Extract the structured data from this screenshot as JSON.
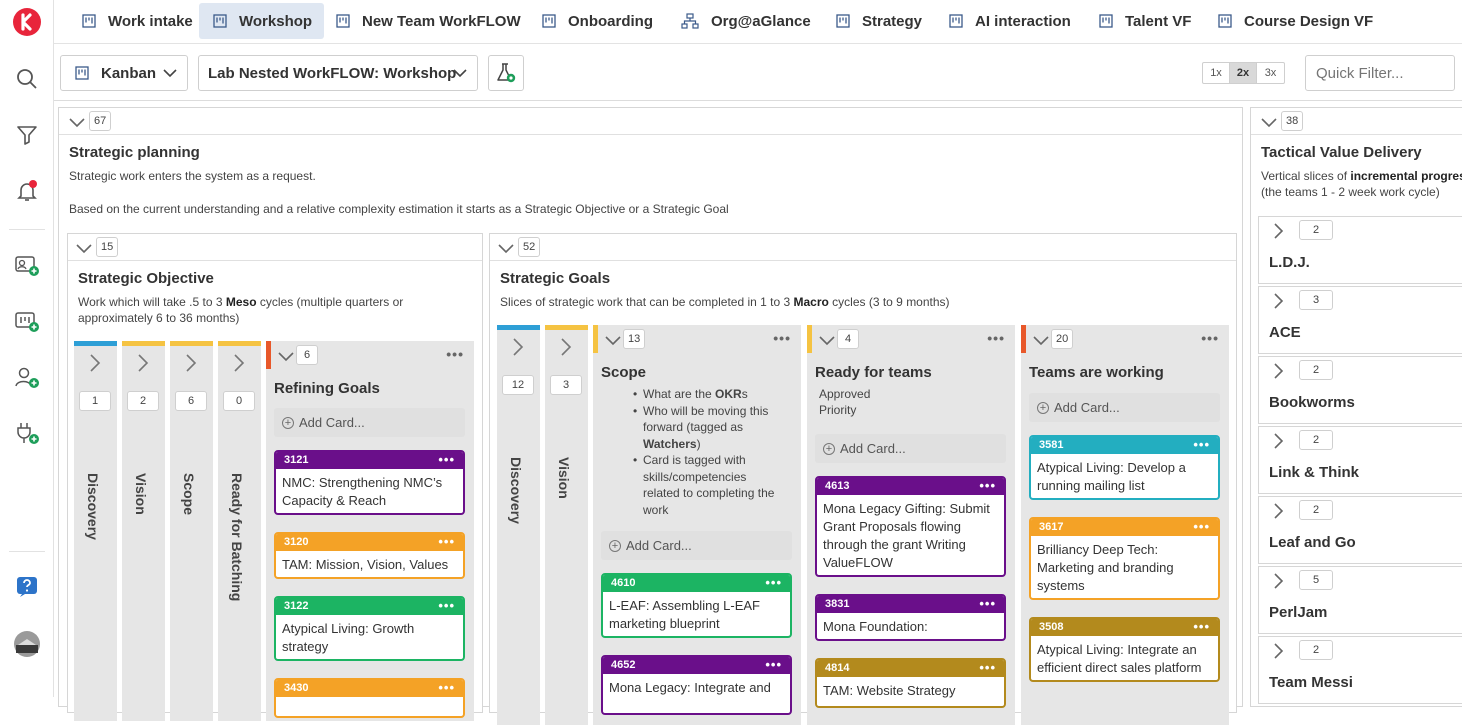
{
  "tabs": [
    {
      "label": "Work intake",
      "icon": "board-icon"
    },
    {
      "label": "Workshop",
      "icon": "board-icon",
      "active": true
    },
    {
      "label": "New Team WorkFLOW",
      "icon": "board-icon"
    },
    {
      "label": "Onboarding",
      "icon": "board-icon"
    },
    {
      "label": "Org@aGlance",
      "icon": "org-chart-icon"
    },
    {
      "label": "Strategy",
      "icon": "board-icon"
    },
    {
      "label": "AI interaction",
      "icon": "board-icon"
    },
    {
      "label": "Talent VF",
      "icon": "board-icon"
    },
    {
      "label": "Course Design VF",
      "icon": "board-icon"
    }
  ],
  "toolbar": {
    "view_label": "Kanban",
    "board_label": "Lab Nested WorkFLOW: Workshop",
    "zoom": [
      "1x",
      "2x",
      "3x"
    ],
    "zoom_selected": "2x",
    "quick_filter_placeholder": "Quick Filter..."
  },
  "colors": {
    "accent": "#e8253b",
    "purple": "#6a0f8a",
    "orange": "#f4a226",
    "green": "#1cb463",
    "teal": "#23aec0",
    "gold": "#b38a1d",
    "red": "#e8582a",
    "blue": "#2e9fd6",
    "yellow": "#f5c342"
  },
  "strategic": {
    "count": "67",
    "title": "Strategic planning",
    "desc1": "Strategic work enters the system as a request.",
    "desc2": "Based on the current understanding and a relative complexity estimation it starts as a Strategic Objective or a Strategic Goal",
    "objective": {
      "count": "15",
      "title": "Strategic Objective",
      "desc_a": "Work which will take .5 to 3 ",
      "desc_b": "Meso",
      "desc_c": " cycles (multiple quarters or approximately 6 to 36 months)",
      "cols": [
        {
          "label": "Discovery",
          "count": "1"
        },
        {
          "label": "Vision",
          "count": "2"
        },
        {
          "label": "Scope",
          "count": "6"
        },
        {
          "label": "Ready for Batching",
          "count": "0"
        }
      ],
      "refining": {
        "count": "6",
        "title": "Refining Goals",
        "add": "Add Card...",
        "cards": [
          {
            "id": "3121",
            "text": "NMC: Strengthening NMC’s Capacity & Reach"
          },
          {
            "id": "3120",
            "text": "TAM: Mission, Vision, Values"
          },
          {
            "id": "3122",
            "text": "Atypical Living: Growth strategy"
          },
          {
            "id": "3430",
            "text": ""
          }
        ]
      }
    },
    "goals": {
      "count": "52",
      "title": "Strategic Goals",
      "desc_a": "Slices of strategic work that can be completed in 1 to 3 ",
      "desc_b": "Macro",
      "desc_c": " cycles (3 to 9 months)",
      "cols": [
        {
          "label": "Discovery",
          "count": "12"
        },
        {
          "label": "Vision",
          "count": "3"
        }
      ],
      "scope": {
        "count": "13",
        "title": "Scope",
        "b1a": "What are the ",
        "b1b": "OKR",
        "b1c": "s",
        "b2a": "Who will be moving this forward (tagged as ",
        "b2b": "Watchers",
        "b2c": ")",
        "b3": "Card is tagged with skills/competencies related to completing the work",
        "add": "Add Card...",
        "cards": [
          {
            "id": "4610",
            "text": "L-EAF: Assembling L-EAF marketing blueprint"
          },
          {
            "id": "4652",
            "text": "Mona Legacy: Integrate and"
          }
        ]
      },
      "ready": {
        "count": "4",
        "title": "Ready for teams",
        "sub1": "Approved",
        "sub2": "Priority",
        "add": "Add Card...",
        "cards": [
          {
            "id": "4613",
            "text": "Mona Legacy Gifting: Submit Grant Proposals flowing through the grant Writing ValueFLOW"
          },
          {
            "id": "3831",
            "text": "Mona Foundation:"
          },
          {
            "id": "4814",
            "text": "TAM: Website Strategy"
          }
        ]
      },
      "working": {
        "count": "20",
        "title": "Teams are working",
        "add": "Add Card...",
        "cards": [
          {
            "id": "3581",
            "text": "Atypical Living: Develop a running mailing list"
          },
          {
            "id": "3617",
            "text": "Brilliancy Deep Tech: Marketing and branding systems"
          },
          {
            "id": "3508",
            "text": "Atypical Living: Integrate an efficient direct sales platform"
          }
        ]
      }
    }
  },
  "tactical": {
    "count": "38",
    "title": "Tactical Value Delivery",
    "desc_a": "Vertical slices of ",
    "desc_b": "incremental progres",
    "desc_c": "(the teams 1 - 2 week work cycle)",
    "teams": [
      {
        "name": "L.D.J.",
        "count": "2"
      },
      {
        "name": "ACE",
        "count": "3"
      },
      {
        "name": "Bookworms",
        "count": "2"
      },
      {
        "name": "Link & Think",
        "count": "2"
      },
      {
        "name": "Leaf and Go",
        "count": "2"
      },
      {
        "name": "PerlJam",
        "count": "5"
      },
      {
        "name": "Team Messi",
        "count": "2"
      }
    ]
  },
  "dots": "•••"
}
